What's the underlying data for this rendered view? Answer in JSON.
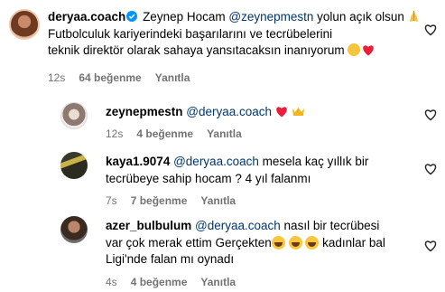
{
  "comments": [
    {
      "username": "deryaa.coach",
      "mention": "@zeynepmestn",
      "text_before": " Zeynep Hocam ",
      "text_after": " yolun açık olsun ",
      "line2": " Futbolculuk kariyerindeki başarılarını ve tecrübelerini",
      "line3": "teknik direktör olarak sahaya yansıtacaksın inanıyorum ",
      "time": "12s",
      "likes": "64 beğenme",
      "reply": "Yanıtla"
    },
    {
      "username": "zeynepmestn",
      "mention": "@deryaa.coach",
      "time": "12s",
      "likes": "4 beğenme",
      "reply": "Yanıtla"
    },
    {
      "username": "kaya1.9074",
      "mention": "@deryaa.coach",
      "text_after": " mesela kaç yıllık bir",
      "line2": "tecrübeye sahip hocam ? 4 yıl falanmı",
      "time": "7s",
      "likes": "7 beğenme",
      "reply": "Yanıtla"
    },
    {
      "username": "azer_bulbulum",
      "mention": "@deryaa.coach",
      "text_after": " nasıl bir tecrübesi",
      "line2_a": "var çok merak ettim Gerçekten",
      "line2_b": " kadınlar bal",
      "line3": "Ligi'nde falan mı oynadı",
      "time": "4s",
      "likes": "4 beğenme",
      "reply": "Yanıtla"
    }
  ],
  "colors": {
    "verified": "#0095f6",
    "mention": "#00376b",
    "meta": "#737373",
    "heart_red": "#ed1c3a"
  },
  "icons": [
    "verified-badge-icon",
    "folded-hands-icon",
    "ok-hand-icon",
    "red-heart-icon",
    "crown-icon",
    "laughing-face-icon",
    "like-heart-outline-icon"
  ]
}
